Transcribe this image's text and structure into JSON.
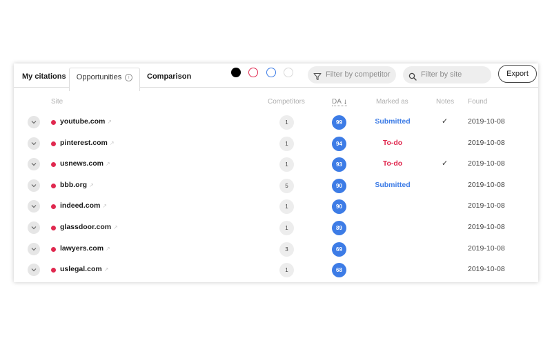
{
  "tabs": {
    "citations": "My citations",
    "opportunities": "Opportunities",
    "opportunities_info": "i",
    "comparison": "Comparison"
  },
  "swatches": [
    {
      "color": "#000000",
      "filled": true
    },
    {
      "color": "#e0294f",
      "filled": false
    },
    {
      "color": "#3d7ce6",
      "filled": false
    },
    {
      "color": "#dddddd",
      "filled": false
    }
  ],
  "filters": {
    "competitor_placeholder": "Filter by competitor",
    "site_placeholder": "Filter by site",
    "export_label": "Export"
  },
  "columns": {
    "site": "Site",
    "competitors": "Competitors",
    "da": "DA",
    "da_sort": "↓",
    "marked_as": "Marked as",
    "notes": "Notes",
    "found": "Found"
  },
  "colors": {
    "accent_blue": "#3d7ce6",
    "accent_red": "#e0294f"
  },
  "rows": [
    {
      "site": "youtube.com",
      "competitors": "1",
      "da": "99",
      "marked": "Submitted",
      "marked_type": "blue",
      "note": "✓",
      "found": "2019-10-08"
    },
    {
      "site": "pinterest.com",
      "competitors": "1",
      "da": "94",
      "marked": "To-do",
      "marked_type": "red",
      "note": "",
      "found": "2019-10-08"
    },
    {
      "site": "usnews.com",
      "competitors": "1",
      "da": "93",
      "marked": "To-do",
      "marked_type": "red",
      "note": "✓",
      "found": "2019-10-08"
    },
    {
      "site": "bbb.org",
      "competitors": "5",
      "da": "90",
      "marked": "Submitted",
      "marked_type": "blue",
      "note": "",
      "found": "2019-10-08"
    },
    {
      "site": "indeed.com",
      "competitors": "1",
      "da": "90",
      "marked": "",
      "marked_type": "",
      "note": "",
      "found": "2019-10-08"
    },
    {
      "site": "glassdoor.com",
      "competitors": "1",
      "da": "89",
      "marked": "",
      "marked_type": "",
      "note": "",
      "found": "2019-10-08"
    },
    {
      "site": "lawyers.com",
      "competitors": "3",
      "da": "69",
      "marked": "",
      "marked_type": "",
      "note": "",
      "found": "2019-10-08"
    },
    {
      "site": "uslegal.com",
      "competitors": "1",
      "da": "68",
      "marked": "",
      "marked_type": "",
      "note": "",
      "found": "2019-10-08"
    }
  ]
}
